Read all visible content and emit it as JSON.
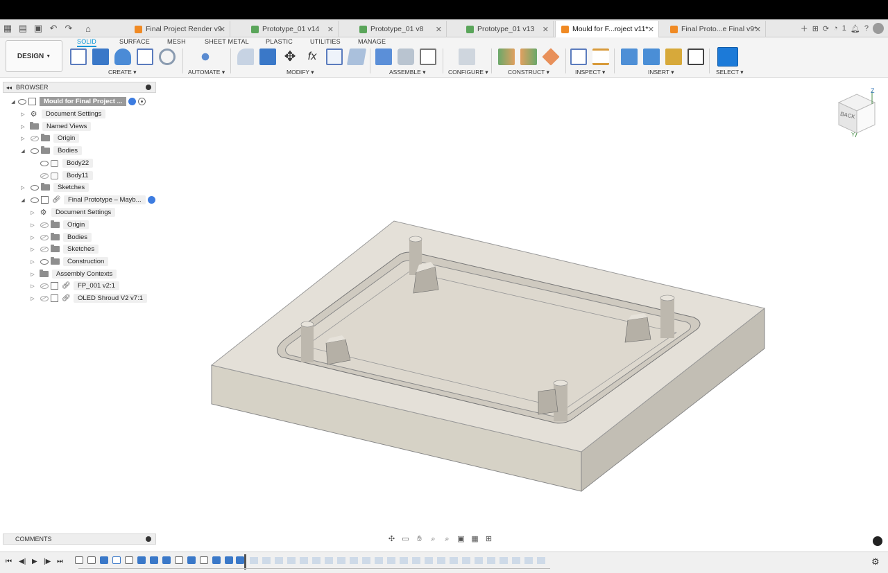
{
  "tabs": [
    {
      "label": "Final Project Render v9",
      "color": "#f08a24"
    },
    {
      "label": "Prototype_01 v14",
      "color": "#5aa55a"
    },
    {
      "label": "Prototype_01 v8",
      "color": "#5aa55a"
    },
    {
      "label": "Prototype_01 v13",
      "color": "#5aa55a"
    },
    {
      "label": "Mould for F...roject v11*",
      "color": "#f08a24"
    },
    {
      "label": "Final Proto...e Final v9*",
      "color": "#f08a24"
    }
  ],
  "topbar": {
    "notifications": "1"
  },
  "ribbon": {
    "design": "DESIGN",
    "tabs": [
      "SOLID",
      "SURFACE",
      "MESH",
      "SHEET METAL",
      "PLASTIC",
      "UTILITIES",
      "MANAGE"
    ],
    "groups": [
      "CREATE",
      "AUTOMATE",
      "MODIFY",
      "ASSEMBLE",
      "CONFIGURE",
      "CONSTRUCT",
      "INSPECT",
      "INSERT",
      "SELECT"
    ]
  },
  "browser": {
    "title": "BROWSER",
    "root": "Mould for Final Project ...",
    "items": [
      "Document Settings",
      "Named Views",
      "Origin",
      "Bodies",
      "Body22",
      "Body11",
      "Sketches",
      "Final Prototype – Mayb...",
      "Document Settings",
      "Origin",
      "Bodies",
      "Sketches",
      "Construction",
      "Assembly Contexts",
      "FP_001 v2:1",
      "OLED Shroud V2 v7:1"
    ]
  },
  "comments": "COMMENTS",
  "viewcube": {
    "face": "BACK",
    "axis_z": "Z",
    "axis_y": "Y"
  },
  "colors": {
    "accent": "#0696d7",
    "model_top": "#e4e0d8",
    "model_side": "#d6d2c8"
  }
}
